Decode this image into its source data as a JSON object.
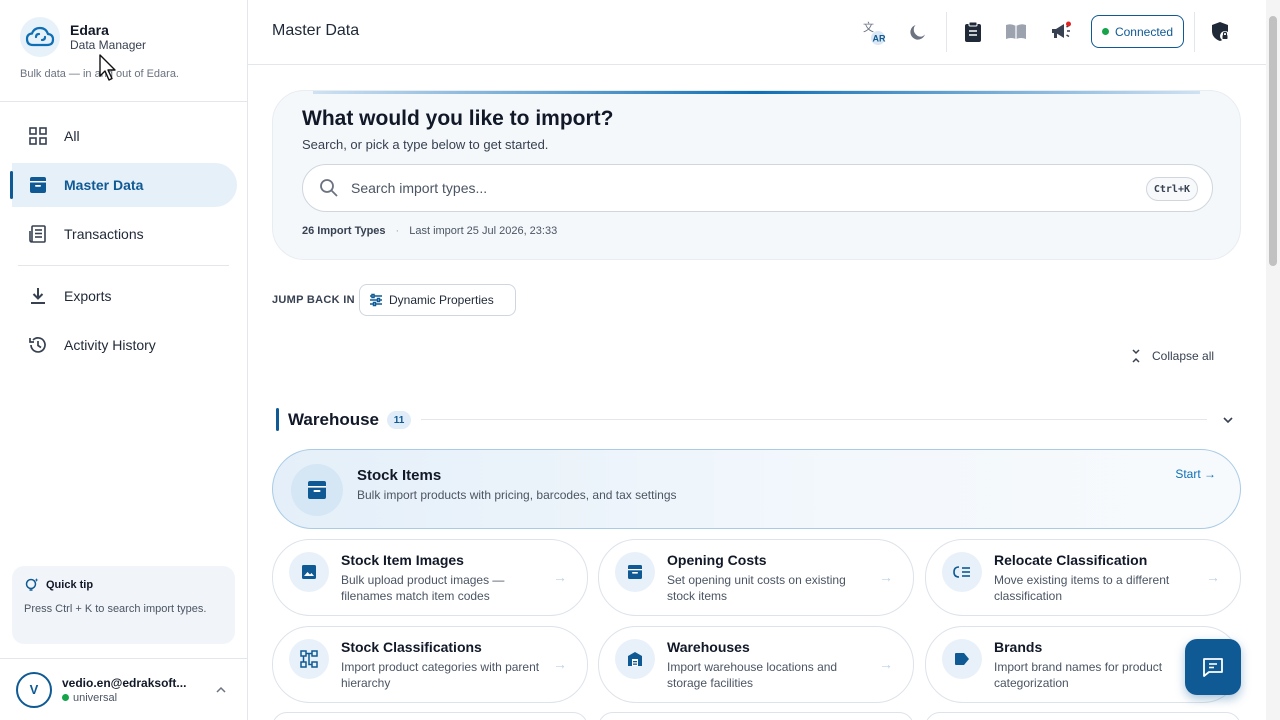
{
  "brand": {
    "name": "Edara",
    "subtitle": "Data Manager",
    "tagline": "Bulk data — in and out of Edara."
  },
  "nav": {
    "items": [
      {
        "label": "All",
        "icon": "grid-icon",
        "active": false
      },
      {
        "label": "Master Data",
        "icon": "archive-icon",
        "active": true
      },
      {
        "label": "Transactions",
        "icon": "receipt-icon",
        "active": false
      },
      {
        "label": "Exports",
        "icon": "download-icon",
        "active": false
      },
      {
        "label": "Activity History",
        "icon": "history-icon",
        "active": false
      }
    ]
  },
  "tip": {
    "title": "Quick tip",
    "body": "Press Ctrl + K to search import types."
  },
  "user": {
    "initial": "V",
    "email": "vedio.en@edraksoft...",
    "org": "universal"
  },
  "header": {
    "title": "Master Data",
    "status": "Connected",
    "language_badge": "AR"
  },
  "hero": {
    "title": "What would you like to import?",
    "subtitle": "Search, or pick a type below to get started.",
    "search_placeholder": "Search import types...",
    "shortcut": "Ctrl+K",
    "count": "26 Import Types",
    "last_import": "Last import 25 Jul 2026, 23:33"
  },
  "jump": {
    "label": "JUMP BACK IN",
    "chip": "Dynamic Properties"
  },
  "collapse_label": "Collapse all",
  "section": {
    "title": "Warehouse",
    "count": "11"
  },
  "featured": {
    "title": "Stock Items",
    "desc": "Bulk import products with pricing, barcodes, and tax settings",
    "action": "Start →"
  },
  "cards": [
    {
      "title": "Stock Item Images",
      "desc": "Bulk upload product images — filenames match item codes",
      "icon": "image-icon"
    },
    {
      "title": "Opening Costs",
      "desc": "Set opening unit costs on existing stock items",
      "icon": "archive-icon"
    },
    {
      "title": "Relocate Classification",
      "desc": "Move existing items to a different classification",
      "icon": "relocate-icon"
    },
    {
      "title": "Stock Classifications",
      "desc": "Import product categories with parent hierarchy",
      "icon": "hierarchy-icon"
    },
    {
      "title": "Warehouses",
      "desc": "Import warehouse locations and storage facilities",
      "icon": "warehouse-icon"
    },
    {
      "title": "Brands",
      "desc": "Import brand names for product categorization",
      "icon": "tag-icon"
    }
  ],
  "colors": {
    "primary": "#0f5a94",
    "accent": "#0f6fb5",
    "success": "#16a34a",
    "notify": "#dc2626"
  }
}
